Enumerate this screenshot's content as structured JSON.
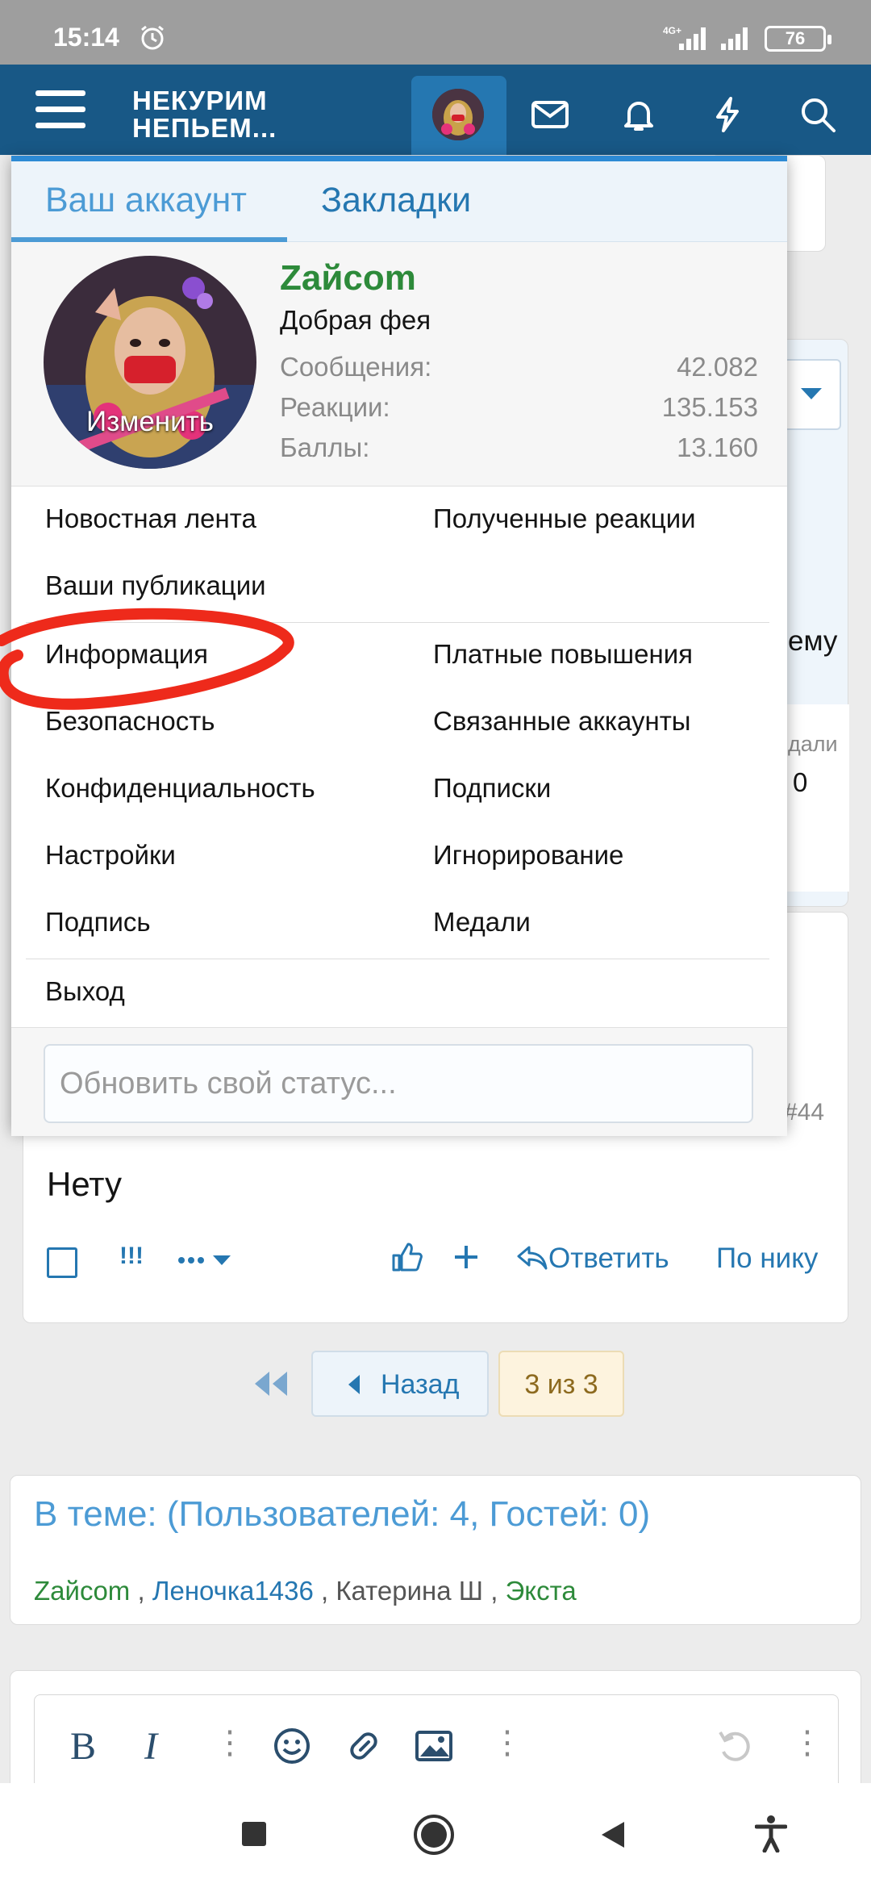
{
  "statusbar": {
    "time": "15:14",
    "net_label": "4G+",
    "battery": "76"
  },
  "header": {
    "logo_line1": "НЕКУРИМ",
    "logo_line2": "НЕПЬЕМ..."
  },
  "menu": {
    "tabs": [
      {
        "label": "Ваш аккаунт"
      },
      {
        "label": "Закладки"
      }
    ],
    "profile": {
      "avatar_overlay": "Изменить",
      "username": "Zайcom",
      "user_title": "Добрая фея",
      "stats": [
        {
          "label": "Сообщения:",
          "value": "42.082"
        },
        {
          "label": "Реакции:",
          "value": "135.153"
        },
        {
          "label": "Баллы:",
          "value": "13.160"
        }
      ]
    },
    "links": {
      "news_feed": "Новостная лента",
      "received_reactions": "Полученные реакции",
      "your_posts": "Ваши публикации",
      "info": "Информация",
      "paid_upgrades": "Платные повышения",
      "security": "Безопасность",
      "linked_accounts": "Связанные аккаунты",
      "privacy": "Конфиденциальность",
      "subscriptions": "Подписки",
      "settings": "Настройки",
      "ignoring": "Игнорирование",
      "signature": "Подпись",
      "medals": "Медали",
      "logout": "Выход"
    },
    "status_placeholder": "Обновить свой статус..."
  },
  "background": {
    "peek_text_1": "ему",
    "peek_text_2": "дали",
    "peek_text_3": "0",
    "post_number": "#44",
    "post_text": "Нету",
    "action_mark": "!!!",
    "reply_label": "Ответить",
    "by_nick_label": "По нику",
    "pager_back_label": "Назад",
    "pager_current": "3 из 3",
    "in_topic_title": "В теме: (Пользователей: 4, Гостей: 0)",
    "users": [
      "Zайcom",
      "Леночка1436",
      "Катерина Ш",
      "Экста"
    ]
  },
  "colors": {
    "header_bg": "#185886",
    "accent": "#2577b1",
    "accent_light": "#4c9bd5",
    "username_green": "#2d8a3a",
    "annotation_red": "#ee2a1b"
  }
}
